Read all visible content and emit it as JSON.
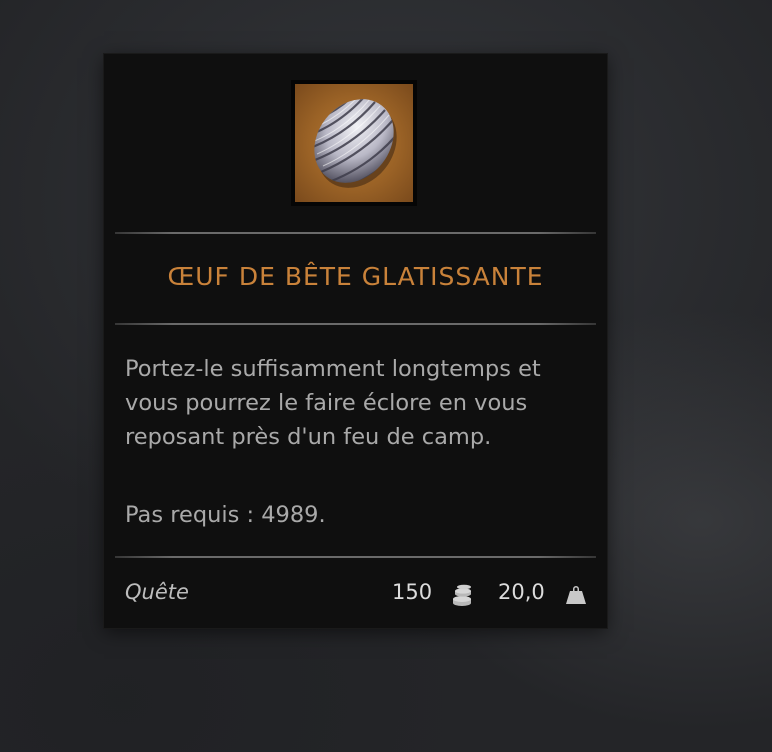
{
  "item": {
    "name": "ŒUF DE BÊTE GLATISSANTE",
    "icon": "striped-egg-icon",
    "description": "Portez-le suffisamment longtemps et vous pourrez le faire éclore en vous reposant près d'un feu de camp.",
    "steps_required": "Pas requis : 4989.",
    "category": "Quête",
    "value": "150",
    "value_icon": "coin-stack-icon",
    "weight": "20,0",
    "weight_icon": "weight-icon"
  },
  "colors": {
    "title": "#c9823a",
    "text": "#a9a9a9",
    "panel": "#0f0f0f",
    "icon_background": "#9a6226"
  }
}
